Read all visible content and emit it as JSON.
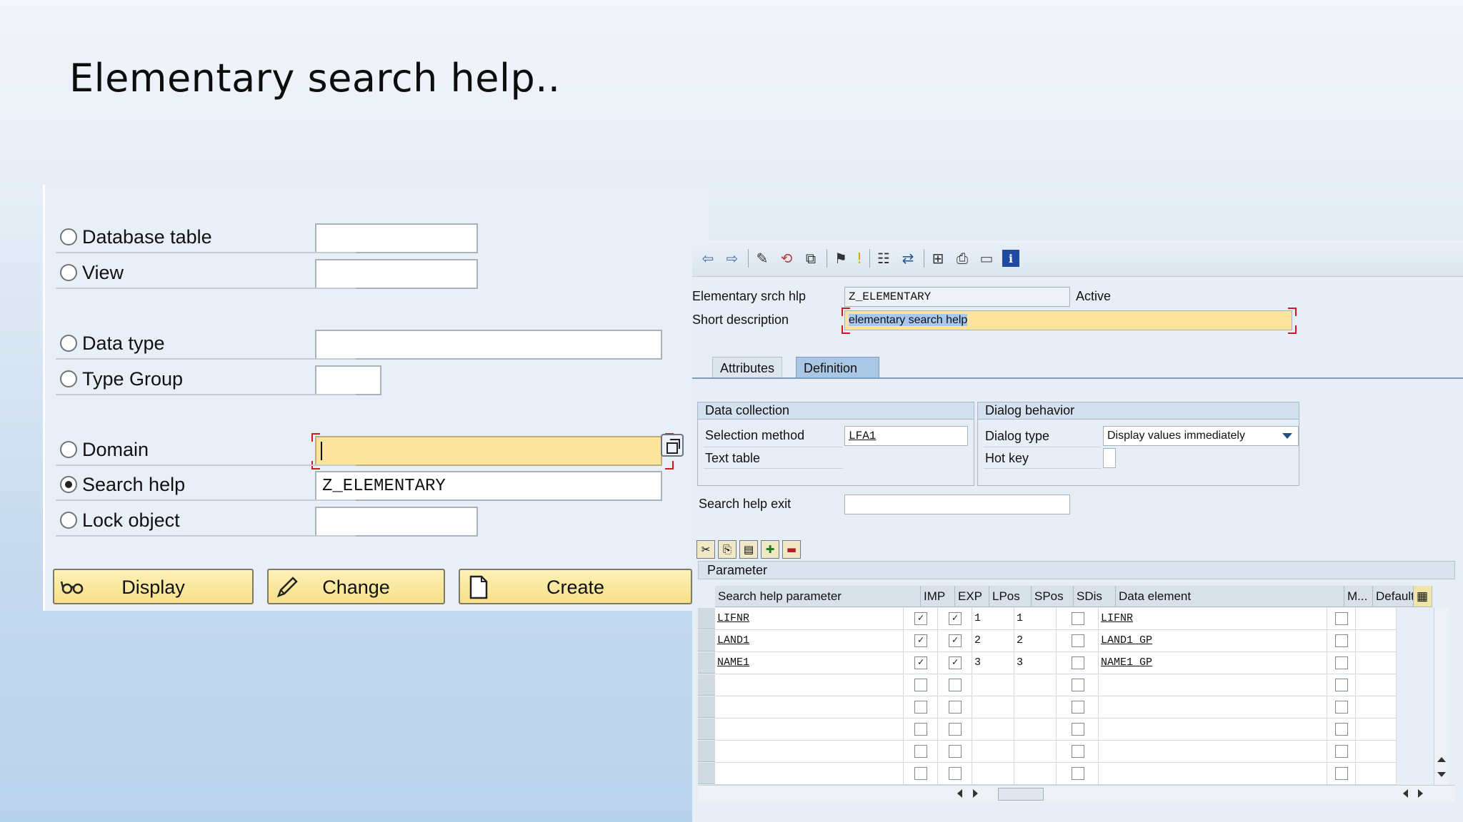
{
  "slide": {
    "title": "Elementary search help.."
  },
  "object_selector": {
    "rows": [
      {
        "label": "Database table",
        "value": "",
        "checked": false
      },
      {
        "label": "View",
        "value": "",
        "checked": false
      },
      {
        "label": "Data type",
        "value": "",
        "checked": false
      },
      {
        "label": "Type Group",
        "value": "",
        "checked": false
      },
      {
        "label": "Domain",
        "value": "",
        "checked": false
      },
      {
        "label": "Search help",
        "value": "Z_ELEMENTARY",
        "checked": true
      },
      {
        "label": "Lock object",
        "value": "",
        "checked": false
      }
    ],
    "buttons": {
      "display": "Display",
      "change": "Change",
      "create": "Create"
    }
  },
  "search_help_editor": {
    "name_label": "Elementary srch hlp",
    "name_value": "Z_ELEMENTARY",
    "status": "Active",
    "desc_label": "Short description",
    "desc_value": "elementary search help",
    "tabs": [
      "Attributes",
      "Definition"
    ],
    "active_tab": "Definition",
    "data_collection": {
      "title": "Data collection",
      "selection_method_label": "Selection method",
      "selection_method_value": "LFA1",
      "text_table_label": "Text table"
    },
    "dialog_behavior": {
      "title": "Dialog behavior",
      "dialog_type_label": "Dialog type",
      "dialog_type_value": "Display values immediately",
      "hot_key_label": "Hot key"
    },
    "exit_label": "Search help exit",
    "parameter": {
      "title": "Parameter",
      "columns": [
        "Search help parameter",
        "IMP",
        "EXP",
        "LPos",
        "SPos",
        "SDis",
        "Data element",
        "M...",
        "Default"
      ],
      "rows": [
        {
          "param": "LIFNR",
          "imp": true,
          "exp": true,
          "lpos": "1",
          "spos": "1",
          "sdis": false,
          "data_element": "LIFNR",
          "m": false
        },
        {
          "param": "LAND1",
          "imp": true,
          "exp": true,
          "lpos": "2",
          "spos": "2",
          "sdis": false,
          "data_element": "LAND1_GP",
          "m": false
        },
        {
          "param": "NAME1",
          "imp": true,
          "exp": true,
          "lpos": "3",
          "spos": "3",
          "sdis": false,
          "data_element": "NAME1_GP",
          "m": false
        },
        {
          "param": "",
          "imp": false,
          "exp": false,
          "lpos": "",
          "spos": "",
          "sdis": false,
          "data_element": "",
          "m": false
        },
        {
          "param": "",
          "imp": false,
          "exp": false,
          "lpos": "",
          "spos": "",
          "sdis": false,
          "data_element": "",
          "m": false
        },
        {
          "param": "",
          "imp": false,
          "exp": false,
          "lpos": "",
          "spos": "",
          "sdis": false,
          "data_element": "",
          "m": false
        },
        {
          "param": "",
          "imp": false,
          "exp": false,
          "lpos": "",
          "spos": "",
          "sdis": false,
          "data_element": "",
          "m": false
        },
        {
          "param": "",
          "imp": false,
          "exp": false,
          "lpos": "",
          "spos": "",
          "sdis": false,
          "data_element": "",
          "m": false
        }
      ]
    }
  },
  "colors": {
    "focus_yellow": "#fbe59c",
    "button_yellow": "#f7e08a",
    "tab_active": "#a9c6e4",
    "required_marker": "#d0181a"
  },
  "icons": [
    "back-arrow-icon",
    "forward-arrow-icon",
    "edit-pencil-icon",
    "display-change-icon",
    "check-icon",
    "activate-icon",
    "where-used-icon",
    "object-list-icon",
    "navigation-icon",
    "hierarchy-icon",
    "print-icon",
    "window-icon",
    "info-icon",
    "copy-icon"
  ]
}
